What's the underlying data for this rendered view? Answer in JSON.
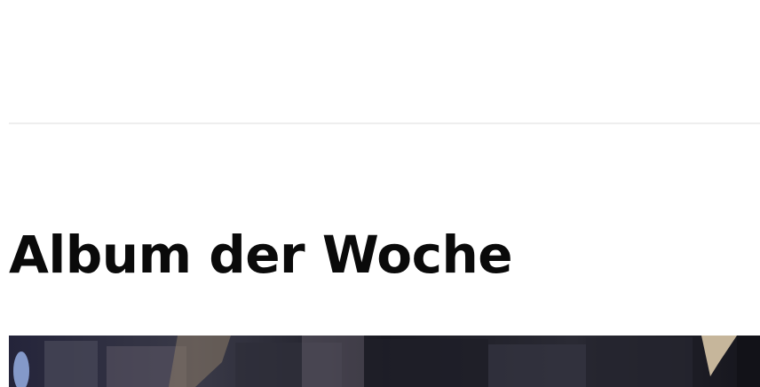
{
  "section": {
    "title": "Album der Woche"
  },
  "album": {
    "cover_image": "album-cover-artwork"
  },
  "colors": {
    "background": "#ffffff",
    "divider": "#eeeeee",
    "title_text": "#0a0a0a",
    "cover_base": "#1c1c28"
  }
}
